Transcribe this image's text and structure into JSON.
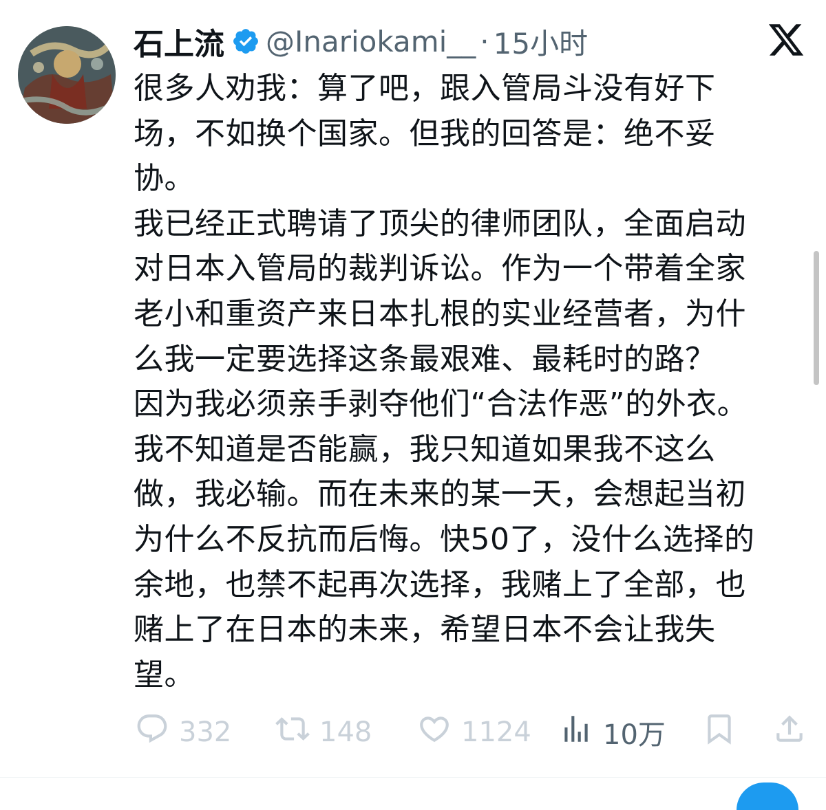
{
  "author": {
    "name": "石上流",
    "handle": "@Inariokami__",
    "separator": "·",
    "time": "15小时",
    "verified_icon": "verified-badge-icon",
    "verified_color": "#1d9bf0"
  },
  "platform_logo": "x-logo-icon",
  "tweet": {
    "lines": [
      "很多人劝我：算了吧，跟入管局斗没有好下",
      "场，不如换个国家。但我的回答是：绝不妥",
      "协。",
      "我已经正式聘请了顶尖的律师团队，全面启动",
      "对日本入管局的裁判诉讼。作为一个带着全家",
      "老小和重资产来日本扎根的实业经营者，为什",
      "么我一定要选择这条最艰难、最耗时的路？",
      "因为我必须亲手剥夺他们“合法作恶”的外衣。",
      "我不知道是否能赢，我只知道如果我不这么",
      "做，我必输。而在未来的某一天，会想起当初",
      "为什么不反抗而后悔。快50了，没什么选择的",
      "余地，也禁不起再次选择，我赌上了全部，也",
      "赌上了在日本的未来，希望日本不会让我失",
      "望。"
    ]
  },
  "actions": {
    "replies": "332",
    "reposts": "148",
    "likes": "1124",
    "views": "10万"
  },
  "colors": {
    "text": "#0f1419",
    "muted": "#536471",
    "icon_muted": "#8b98a5",
    "accent": "#1d9bf0"
  }
}
